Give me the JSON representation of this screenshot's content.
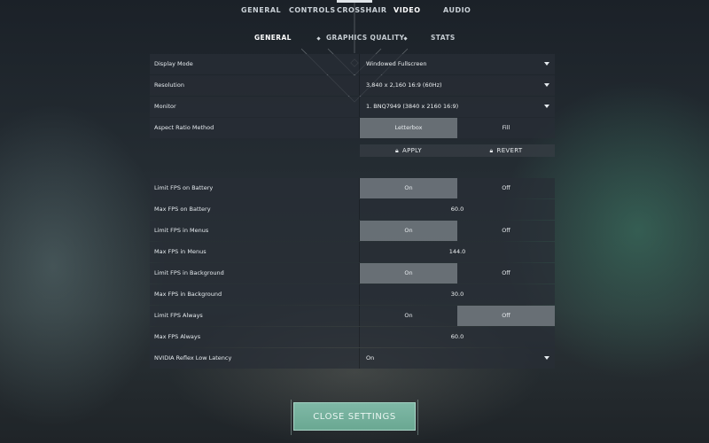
{
  "top_tabs": [
    "GENERAL",
    "CONTROLS",
    "CROSSHAIR",
    "VIDEO",
    "AUDIO"
  ],
  "active_top_tab": "VIDEO",
  "sub_tabs": [
    "GENERAL",
    "GRAPHICS QUALITY",
    "STATS"
  ],
  "active_sub_tab": "GENERAL",
  "settings": {
    "display_mode": {
      "label": "Display Mode",
      "value": "Windowed Fullscreen"
    },
    "resolution": {
      "label": "Resolution",
      "value": "3,840 x 2,160 16:9 (60Hz)"
    },
    "monitor": {
      "label": "Monitor",
      "value": "1. BNQ7949 (3840 x  2160 16:9)"
    },
    "aspect_ratio": {
      "label": "Aspect Ratio Method",
      "options": [
        "Letterbox",
        "Fill"
      ],
      "selected": "Letterbox"
    },
    "apply_label": "APPLY",
    "revert_label": "REVERT",
    "limit_fps_battery": {
      "label": "Limit FPS on Battery",
      "options": [
        "On",
        "Off"
      ],
      "selected": "On"
    },
    "max_fps_battery": {
      "label": "Max FPS on Battery",
      "value": "60.0"
    },
    "limit_fps_menus": {
      "label": "Limit FPS in Menus",
      "options": [
        "On",
        "Off"
      ],
      "selected": "On"
    },
    "max_fps_menus": {
      "label": "Max FPS in Menus",
      "value": "144.0"
    },
    "limit_fps_background": {
      "label": "Limit FPS in Background",
      "options": [
        "On",
        "Off"
      ],
      "selected": "On"
    },
    "max_fps_background": {
      "label": "Max FPS in Background",
      "value": "30.0"
    },
    "limit_fps_always": {
      "label": "Limit FPS Always",
      "options": [
        "On",
        "Off"
      ],
      "selected": "Off"
    },
    "max_fps_always": {
      "label": "Max FPS Always",
      "value": "60.0"
    },
    "nvidia_reflex": {
      "label": "NVIDIA Reflex Low Latency",
      "value": "On"
    }
  },
  "close_label": "CLOSE SETTINGS",
  "colors": {
    "accent": "#72ae9a",
    "panel": "#2a3038",
    "selected": "#737a80"
  }
}
